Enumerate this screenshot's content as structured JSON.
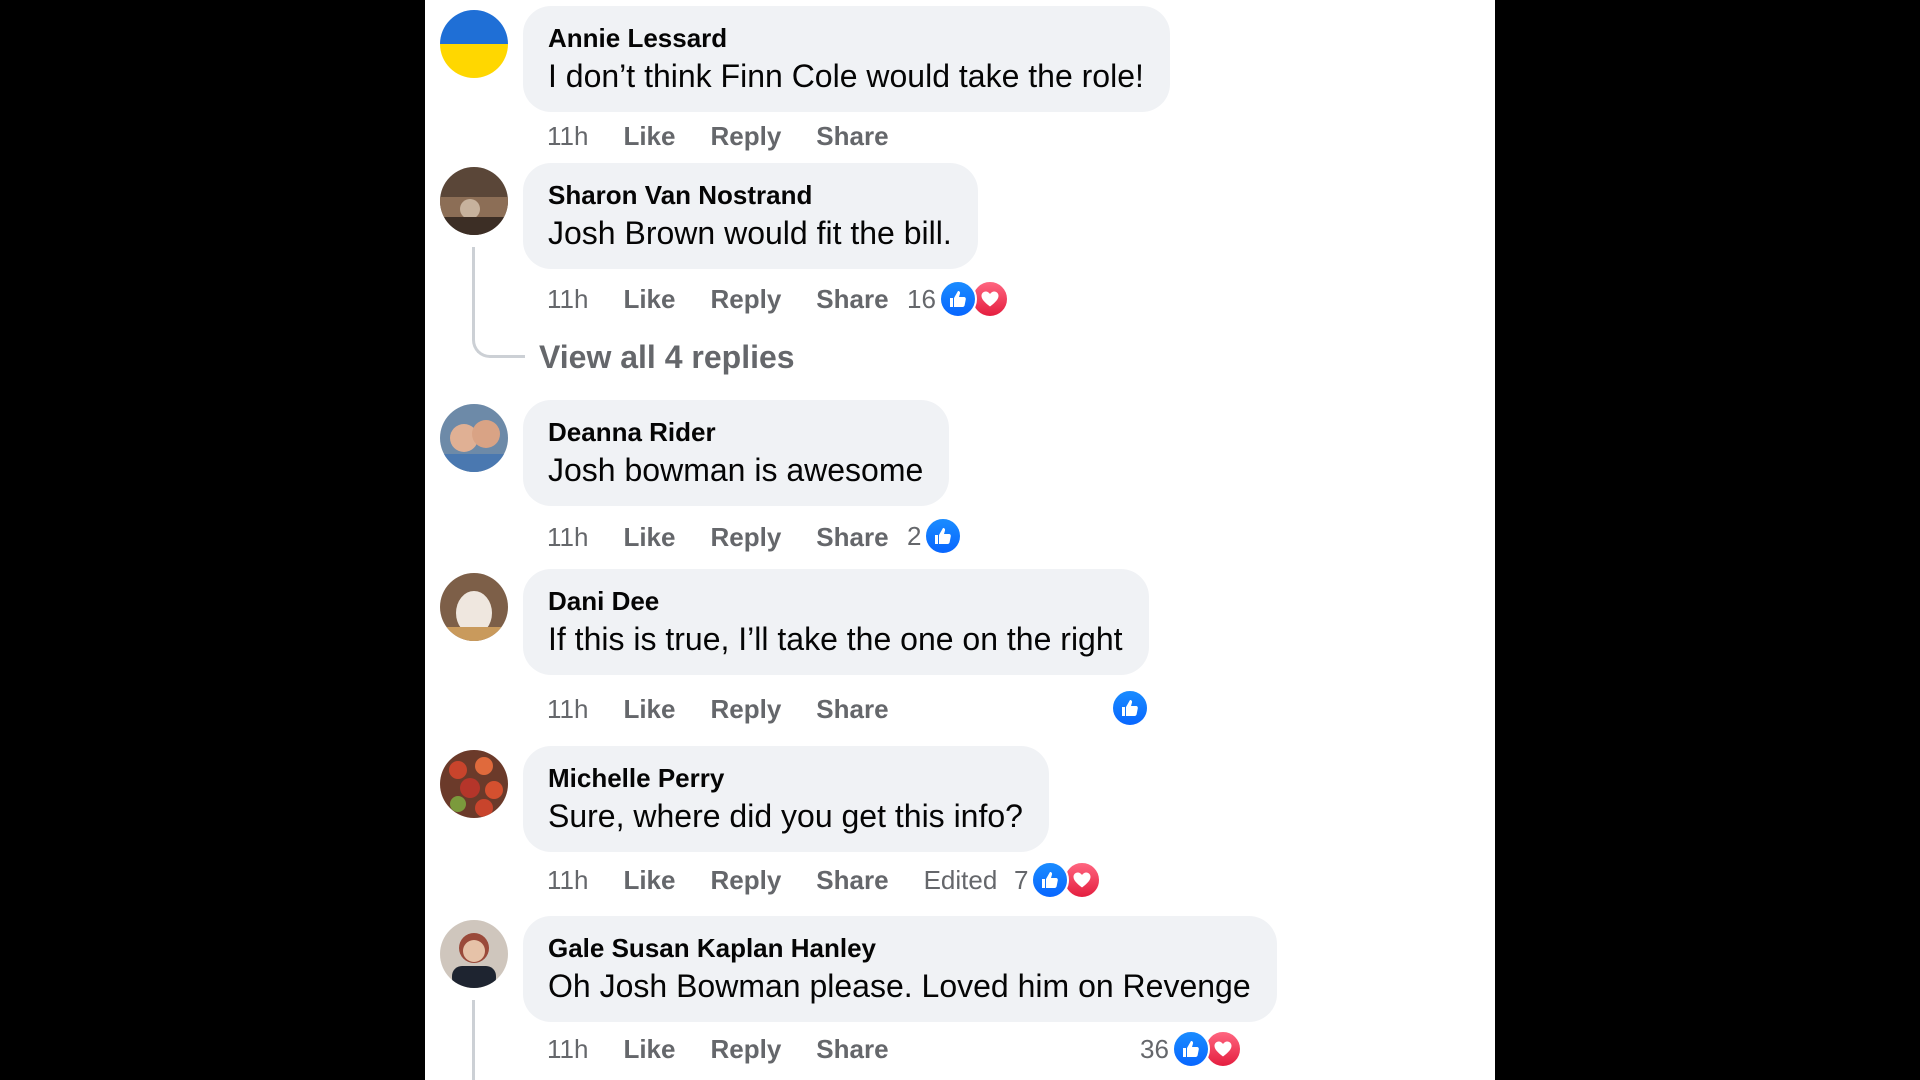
{
  "comments": [
    {
      "author": "Annie Lessard",
      "text": "I don’t think Finn Cole would take the role!",
      "time": "11h",
      "like": "Like",
      "reply": "Reply",
      "share": "Share",
      "reaction_count": ""
    },
    {
      "author": "Sharon Van Nostrand",
      "text": "Josh Brown would fit the bill.",
      "time": "11h",
      "like": "Like",
      "reply": "Reply",
      "share": "Share",
      "reaction_count": "16",
      "view_replies": "View all 4 replies"
    },
    {
      "author": "Deanna Rider",
      "text": "Josh bowman is awesome",
      "time": "11h",
      "like": "Like",
      "reply": "Reply",
      "share": "Share",
      "reaction_count": "2"
    },
    {
      "author": "Dani Dee",
      "text": "If this is true, I’ll take the one on the right",
      "time": "11h",
      "like": "Like",
      "reply": "Reply",
      "share": "Share",
      "reaction_count": ""
    },
    {
      "author": "Michelle Perry",
      "text": "Sure, where did you get this info?",
      "time": "11h",
      "like": "Like",
      "reply": "Reply",
      "share": "Share",
      "edited": "Edited",
      "reaction_count": "7"
    },
    {
      "author": "Gale Susan Kaplan Hanley",
      "text": "Oh Josh Bowman please. Loved him on Revenge",
      "time": "11h",
      "like": "Like",
      "reply": "Reply",
      "share": "Share",
      "reaction_count": "36"
    }
  ],
  "colors": {
    "like_blue": "#0866ff",
    "love_red": "#e41e3f",
    "bubble_gray": "#f0f2f5",
    "meta_gray": "#65676b"
  },
  "icons": {
    "like": "thumbs-up-icon",
    "love": "heart-icon"
  }
}
